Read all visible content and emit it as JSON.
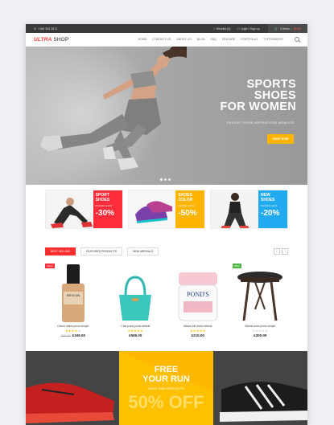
{
  "topbar": {
    "phone": "+186 394 3674",
    "wishlist": "Wishlist (0)",
    "login": "Login / Sign up",
    "cart_label": "0 items -",
    "cart_amount": "$0.00"
  },
  "nav": {
    "logo_a": "ULTRA",
    "logo_b": "SHOP",
    "items": [
      "HOME",
      "CONTACT US",
      "ABOUT US",
      "BLOG",
      "FAQ",
      "FEATURE",
      "PORTFOLIO",
      "TYPOGRAPHY"
    ]
  },
  "hero": {
    "line1": "SPORTS",
    "line2": "SHOES",
    "line3": "FOR WOMEN",
    "subtitle": "PURSUE THESE ASPIRATIONS MOBILIZE",
    "button": "SHOP NOW",
    "slides_total": 3,
    "slide_active": 1
  },
  "banners": [
    {
      "title1": "SPORT",
      "title2": "SHOES",
      "note": "Promotion accord",
      "pct": "-30%",
      "color": "#ff2d3a"
    },
    {
      "title1": "SHOES",
      "title2": "COLOR",
      "note": "Promotion accord",
      "pct": "-50%",
      "color": "#ffb400"
    },
    {
      "title1": "NEW",
      "title2": "SHOES",
      "note": "Promotion accord",
      "pct": "-20%",
      "color": "#22aaf0"
    }
  ],
  "tabs": {
    "items": [
      "BEST SELLING",
      "FEATURED PRODUCTS",
      "NEW ARRIVALS"
    ],
    "active": 0,
    "prev": "‹",
    "next": "›"
  },
  "products": [
    {
      "flag": "SALE",
      "flag_color": "#ff2d3a",
      "name": "Dolore adipis purus simple",
      "rating": 4,
      "old_price": "£400.00",
      "price": "£349.00"
    },
    {
      "flag": "",
      "flag_color": "",
      "name": "Cras posui purus default",
      "rating": 5,
      "old_price": "",
      "price": "£599.00"
    },
    {
      "flag": "",
      "flag_color": "",
      "name": "Mauris elit lectus default",
      "rating": 5,
      "old_price": "",
      "price": "£210.00"
    },
    {
      "flag": "NEW",
      "flag_color": "#4bb543",
      "name": "Mauris amet purus simple",
      "rating": 0,
      "old_price": "",
      "price": "£300.00"
    }
  ],
  "promo": {
    "line1": "FREE",
    "line2": "YOUR RUN",
    "line3": "OVER 1000 PRODUCTS",
    "big": "50% OFF"
  },
  "colors": {
    "accent_red": "#ff2e2e",
    "accent_yellow": "#ffb400",
    "topbar_bg": "#3a3a3a"
  }
}
